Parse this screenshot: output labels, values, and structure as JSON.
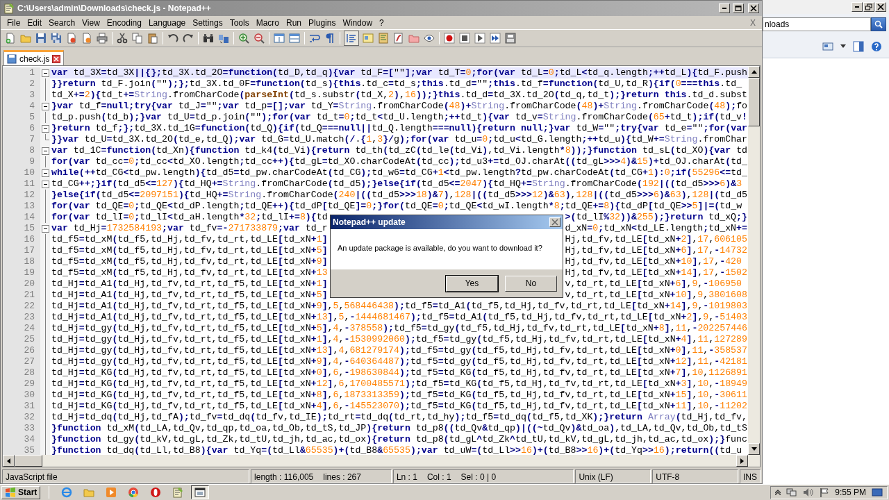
{
  "window": {
    "title": "C:\\Users\\admin\\Downloads\\check.js - Notepad++"
  },
  "menu": [
    "File",
    "Edit",
    "Search",
    "View",
    "Encoding",
    "Language",
    "Settings",
    "Tools",
    "Macro",
    "Run",
    "Plugins",
    "Window",
    "?"
  ],
  "menu_close": "X",
  "tabs": [
    {
      "label": "check.js",
      "selected": true
    }
  ],
  "editor": {
    "lines": [
      {
        "number": "1",
        "kind": "header",
        "current": true,
        "text": "var td_3X=td_3X||{};td_3X.td_2O=function(td_D,td_q){var td_F=[\"\"];var td_T=0;for(var td_L=0;td_L<td_q.length;++td_L){td_F.push"
      },
      {
        "number": "2",
        "kind": "body",
        "current": false,
        "text": "}}return td_F.join(\"\");};td_3X.td_0F=function(td_s){this.td_c=td_s;this.td_d=\"\";this.td_f=function(td_U,td_R){if(0===this.td_"
      },
      {
        "number": "3",
        "kind": "body",
        "current": false,
        "text": "td_X+=2){td_t+=String.fromCharCode(parseInt(td_s.substr(td_X,2),16));}this.td_d=td_3X.td_2O(td_q,td_t);}return this.td_d.subst"
      },
      {
        "number": "4",
        "kind": "header",
        "current": false,
        "text": "}var td_f=null;try{var td_J=\"\";var td_p=[];var td_Y=String.fromCharCode(48)+String.fromCharCode(48)+String.fromCharCode(48);fo"
      },
      {
        "number": "5",
        "kind": "body",
        "current": false,
        "text": "td_p.push(td_b);}var td_U=td_p.join(\"\");for(var td_t=0;td_t<td_U.length;++td_t){var td_v=String.fromCharCode(65+td_t);if(td_v!"
      },
      {
        "number": "6",
        "kind": "header",
        "current": false,
        "text": "}return td_f;};td_3X.td_1G=function(td_Q){if(td_Q===null||td_Q.length===null){return null;}var td_W=\"\";try{var td_e=\"\";for(var"
      },
      {
        "number": "7",
        "kind": "end",
        "current": false,
        "text": "}}var td_U=td_3X.td_2O(td_e,td_Q);var td_G=td_U.match(/.{1,3}/g);for(var td_u=0;td_u<td_G.length;++td_u){td_W+=String.fromChar"
      },
      {
        "number": "8",
        "kind": "header",
        "current": false,
        "text": "var td_1C=function(td_Xn){function td_k4(td_Vi){return td_th(td_zC(td_le(td_Vi),td_Vi.length*8));}function td_sL(td_XO){var td"
      },
      {
        "number": "9",
        "kind": "body",
        "current": false,
        "text": "for(var td_cc=0;td_cc<td_XO.length;td_cc++){td_gL=td_XO.charCodeAt(td_cc);td_u3+=td_OJ.charAt((td_gL>>>4)&15)+td_OJ.charAt(td_"
      },
      {
        "number": "10",
        "kind": "header",
        "current": false,
        "text": "while(++td_CG<td_pw.length){td_d5=td_pw.charCodeAt(td_CG);td_w6=td_CG+1<td_pw.length?td_pw.charCodeAt(td_CG+1):0;if(55296<=td_"
      },
      {
        "number": "11",
        "kind": "header",
        "current": false,
        "text": "td_CG++;}if(td_d5<=127){td_HQ+=String.fromCharCode(td_d5);}else{if(td_d5<=2047){td_HQ+=String.fromCharCode(192|((td_d5>>>6)&3"
      },
      {
        "number": "12",
        "kind": "body",
        "current": false,
        "text": "}else{if(td_d5<=2097151){td_HQ+=String.fromCharCode(240|((td_d5>>>18)&7),128|((td_d5>>>12)&63),128|((td_d5>>>6)&63),128|(td_d5"
      },
      {
        "number": "13",
        "kind": "body",
        "current": false,
        "text": "for(var td_QE=0;td_QE<td_dP.length;td_QE++){td_dP[td_QE]=0;}for(td_QE=0;td_QE<td_wI.length*8;td_QE+=8){td_dP[td_QE>>5]|=(td_w"
      },
      {
        "number": "14",
        "kind": "body",
        "current": false,
        "text": "for(var td_lI=0;td_lI<td_aH.length*32;td_lI+=8){td",
        "text_right": ">(td_lI%32))&255);}return td_xQ;}"
      },
      {
        "number": "15",
        "kind": "header",
        "current": false,
        "text": "var td_Hj=1732584193;var td_fv=-271733879;var td_r",
        "text_right": "d_xN=0;td_xN<td_LE.length;td_xN+="
      },
      {
        "number": "16",
        "kind": "body",
        "current": false,
        "text": "td_f5=td_xM(td_f5,td_Hj,td_fv,td_rt,td_LE[td_xN+1]",
        "text_right": "Hj,td_fv,td_LE[td_xN+2],17,606105"
      },
      {
        "number": "17",
        "kind": "body",
        "current": false,
        "text": "td_f5=td_xM(td_f5,td_Hj,td_fv,td_rt,td_LE[td_xN+5]",
        "text_right": "Hj,td_fv,td_LE[td_xN+6],17,-14732"
      },
      {
        "number": "18",
        "kind": "body",
        "current": false,
        "text": "td_f5=td_xM(td_f5,td_Hj,td_fv,td_rt,td_LE[td_xN+9]",
        "text_right": "Hj,td_fv,td_LE[td_xN+10],17,-420"
      },
      {
        "number": "19",
        "kind": "body",
        "current": false,
        "text": "td_f5=td_xM(td_f5,td_Hj,td_fv,td_rt,td_LE[td_xN+13",
        "text_right": "Hj,td_fv,td_LE[td_xN+14],17,-1502"
      },
      {
        "number": "20",
        "kind": "body",
        "current": false,
        "text": "td_Hj=td_A1(td_Hj,td_fv,td_rt,td_f5,td_LE[td_xN+1]",
        "text_right": "v,td_rt,td_LE[td_xN+6],9,-106950"
      },
      {
        "number": "21",
        "kind": "body",
        "current": false,
        "text": "td_Hj=td_A1(td_Hj,td_fv,td_rt,td_f5,td_LE[td_xN+5]",
        "text_right": "v,td_rt,td_LE[td_xN+10],9,3801608"
      },
      {
        "number": "22",
        "kind": "body",
        "current": false,
        "text": "td_Hj=td_A1(td_Hj,td_fv,td_rt,td_f5,td_LE[td_xN+9],5,568446438);td_f5=td_A1(td_f5,td_Hj,td_fv,td_rt,td_LE[td_xN+14],9,-1019803"
      },
      {
        "number": "23",
        "kind": "body",
        "current": false,
        "text": "td_Hj=td_A1(td_Hj,td_fv,td_rt,td_f5,td_LE[td_xN+13],5,-1444681467);td_f5=td_A1(td_f5,td_Hj,td_fv,td_rt,td_LE[td_xN+2],9,-51403"
      },
      {
        "number": "24",
        "kind": "body",
        "current": false,
        "text": "td_Hj=td_gy(td_Hj,td_fv,td_rt,td_f5,td_LE[td_xN+5],4,-378558);td_f5=td_gy(td_f5,td_Hj,td_fv,td_rt,td_LE[td_xN+8],11,-202257446"
      },
      {
        "number": "25",
        "kind": "body",
        "current": false,
        "text": "td_Hj=td_gy(td_Hj,td_fv,td_rt,td_f5,td_LE[td_xN+1],4,-1530992060);td_f5=td_gy(td_f5,td_Hj,td_fv,td_rt,td_LE[td_xN+4],11,127289"
      },
      {
        "number": "26",
        "kind": "body",
        "current": false,
        "text": "td_Hj=td_gy(td_Hj,td_fv,td_rt,td_f5,td_LE[td_xN+13],4,681279174);td_f5=td_gy(td_f5,td_Hj,td_fv,td_rt,td_LE[td_xN+0],11,-358537"
      },
      {
        "number": "27",
        "kind": "body",
        "current": false,
        "text": "td_Hj=td_gy(td_Hj,td_fv,td_rt,td_f5,td_LE[td_xN+9],4,-640364487);td_f5=td_gy(td_f5,td_Hj,td_fv,td_rt,td_LE[td_xN+12],11,-42181"
      },
      {
        "number": "28",
        "kind": "body",
        "current": false,
        "text": "td_Hj=td_KG(td_Hj,td_fv,td_rt,td_f5,td_LE[td_xN+0],6,-198630844);td_f5=td_KG(td_f5,td_Hj,td_fv,td_rt,td_LE[td_xN+7],10,1126891"
      },
      {
        "number": "29",
        "kind": "body",
        "current": false,
        "text": "td_Hj=td_KG(td_Hj,td_fv,td_rt,td_f5,td_LE[td_xN+12],6,1700485571);td_f5=td_KG(td_f5,td_Hj,td_fv,td_rt,td_LE[td_xN+3],10,-18949"
      },
      {
        "number": "30",
        "kind": "body",
        "current": false,
        "text": "td_Hj=td_KG(td_Hj,td_fv,td_rt,td_f5,td_LE[td_xN+8],6,1873313359);td_f5=td_KG(td_f5,td_Hj,td_fv,td_rt,td_LE[td_xN+15],10,-30611"
      },
      {
        "number": "31",
        "kind": "body",
        "current": false,
        "text": "td_Hj=td_KG(td_Hj,td_fv,td_rt,td_f5,td_LE[td_xN+4],6,-145523070);td_f5=td_KG(td_f5,td_Hj,td_fv,td_rt,td_LE[td_xN+11],10,-11202"
      },
      {
        "number": "32",
        "kind": "body",
        "current": false,
        "text": "td_Hj=td_dq(td_Hj,td_fA);td_fv=td_dq(td_fv,td_IE);td_rt=td_dq(td_rt,td_hy);td_f5=td_dq(td_f5,td_XK);}return Array(td_Hj,td_fv,"
      },
      {
        "number": "33",
        "kind": "body",
        "current": false,
        "text": "}function td_xM(td_LA,td_Qv,td_qp,td_oa,td_Ob,td_tS,td_JP){return td_p8((td_Qv&td_qp)|((~td_Qv)&td_oa),td_LA,td_Qv,td_Ob,td_tS"
      },
      {
        "number": "34",
        "kind": "body",
        "current": false,
        "text": "}function td_gy(td_kV,td_gL,td_Zk,td_tU,td_jh,td_ac,td_ox){return td_p8(td_gL^td_Zk^td_tU,td_kV,td_gL,td_jh,td_ac,td_ox);}func"
      },
      {
        "number": "35",
        "kind": "body",
        "current": false,
        "text": "}function td_dq(td_Ll,td_B8){var td_Yq=(td_Ll&65535)+(td_B8&65535);var td_uW=(td_Ll>>16)+(td_B8>>16)+(td_Yq>>16);return((td_u"
      }
    ]
  },
  "dialog": {
    "title": "Notepad++ update",
    "message": "An update package is available, do you want to download it?",
    "buttons": [
      {
        "label": "Yes",
        "default": true
      },
      {
        "label": "No",
        "default": false
      }
    ]
  },
  "status_bar": [
    {
      "texts": [
        "JavaScript file"
      ]
    },
    {
      "texts": [
        "length : 116,005",
        "lines : 267"
      ]
    },
    {
      "texts": [
        "Ln : 1",
        "Col : 1",
        "Sel : 0 | 0"
      ]
    },
    {
      "texts": [
        "Unix (LF)"
      ]
    },
    {
      "texts": [
        "UTF-8"
      ]
    },
    {
      "texts": [
        "INS"
      ]
    }
  ],
  "side_window": {
    "search_value": "nloads"
  },
  "taskbar": {
    "start": "Start",
    "clock": "9:55 PM"
  }
}
